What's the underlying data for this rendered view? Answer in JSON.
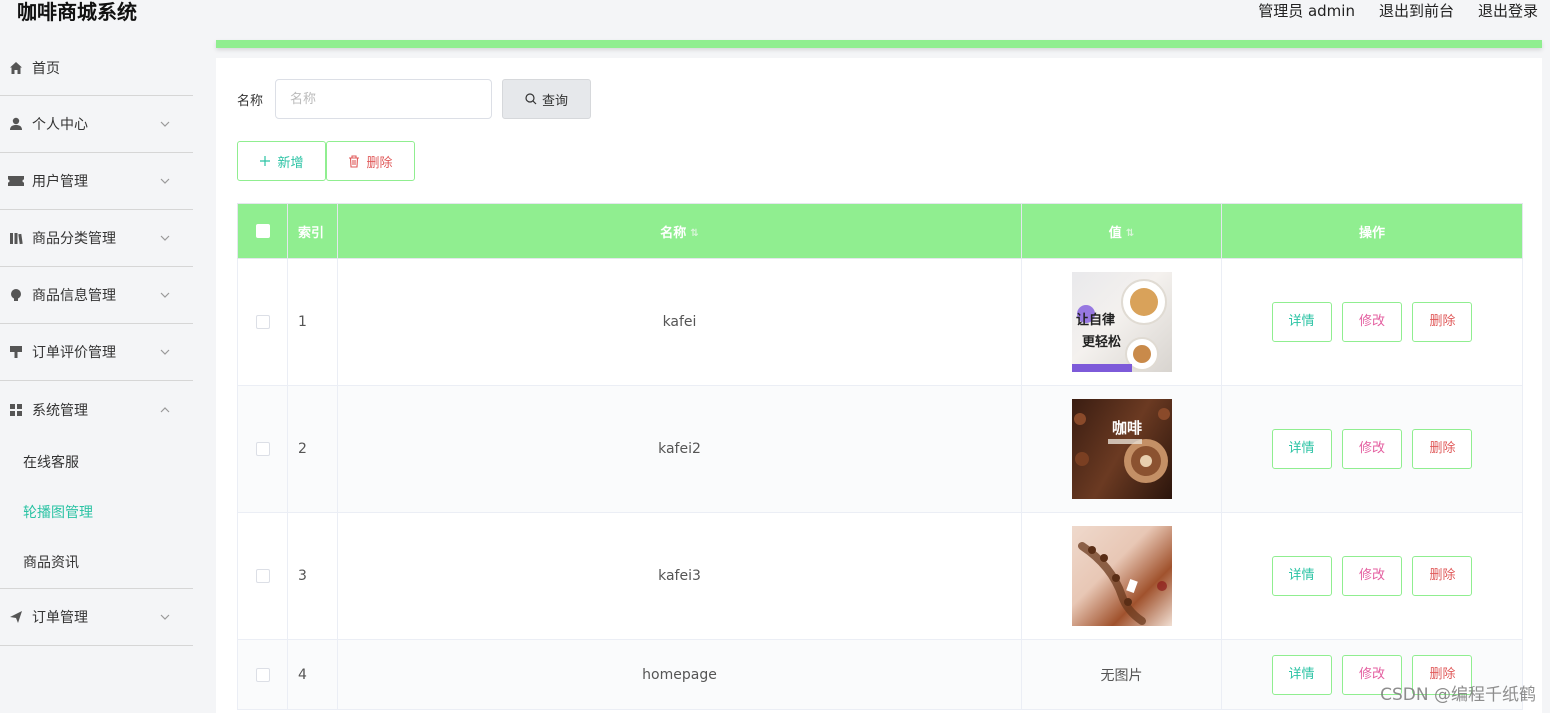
{
  "header": {
    "title": "咖啡商城系统",
    "admin_label": "管理员 admin",
    "exit_front": "退出到前台",
    "logout": "退出登录"
  },
  "sidebar": {
    "items": [
      {
        "label": "首页",
        "icon": "home-icon"
      },
      {
        "label": "个人中心",
        "icon": "user-icon"
      },
      {
        "label": "用户管理",
        "icon": "ticket-icon"
      },
      {
        "label": "商品分类管理",
        "icon": "library-icon"
      },
      {
        "label": "商品信息管理",
        "icon": "bulb-icon"
      },
      {
        "label": "订单评价管理",
        "icon": "stamp-icon"
      },
      {
        "label": "系统管理",
        "icon": "grid-icon"
      }
    ],
    "system_sub": [
      {
        "label": "在线客服"
      },
      {
        "label": "轮播图管理",
        "active": true
      },
      {
        "label": "商品资讯"
      }
    ],
    "order_item": {
      "label": "订单管理",
      "icon": "send-icon"
    }
  },
  "search": {
    "label": "名称",
    "placeholder": "名称",
    "value": "",
    "button": "查询"
  },
  "actions": {
    "add": "新增",
    "delete": "删除"
  },
  "table": {
    "headers": {
      "index": "索引",
      "name": "名称",
      "value": "值",
      "ops": "操作"
    },
    "rows": [
      {
        "index": "1",
        "name": "kafei",
        "value_type": "image"
      },
      {
        "index": "2",
        "name": "kafei2",
        "value_type": "image"
      },
      {
        "index": "3",
        "name": "kafei3",
        "value_type": "image"
      },
      {
        "index": "4",
        "name": "homepage",
        "value_type": "text",
        "value_text": "无图片"
      }
    ],
    "op_labels": {
      "detail": "详情",
      "edit": "修改",
      "remove": "删除"
    }
  },
  "thumb_texts": {
    "t1_line1": "让自律",
    "t1_line2": "更轻松",
    "t2": "咖啡"
  },
  "watermark": "CSDN @编程千纸鹤",
  "colors": {
    "accent_green": "#90ee90",
    "teal": "#2bc3a4",
    "pink": "#e45fa0",
    "red": "#e05a5a"
  }
}
